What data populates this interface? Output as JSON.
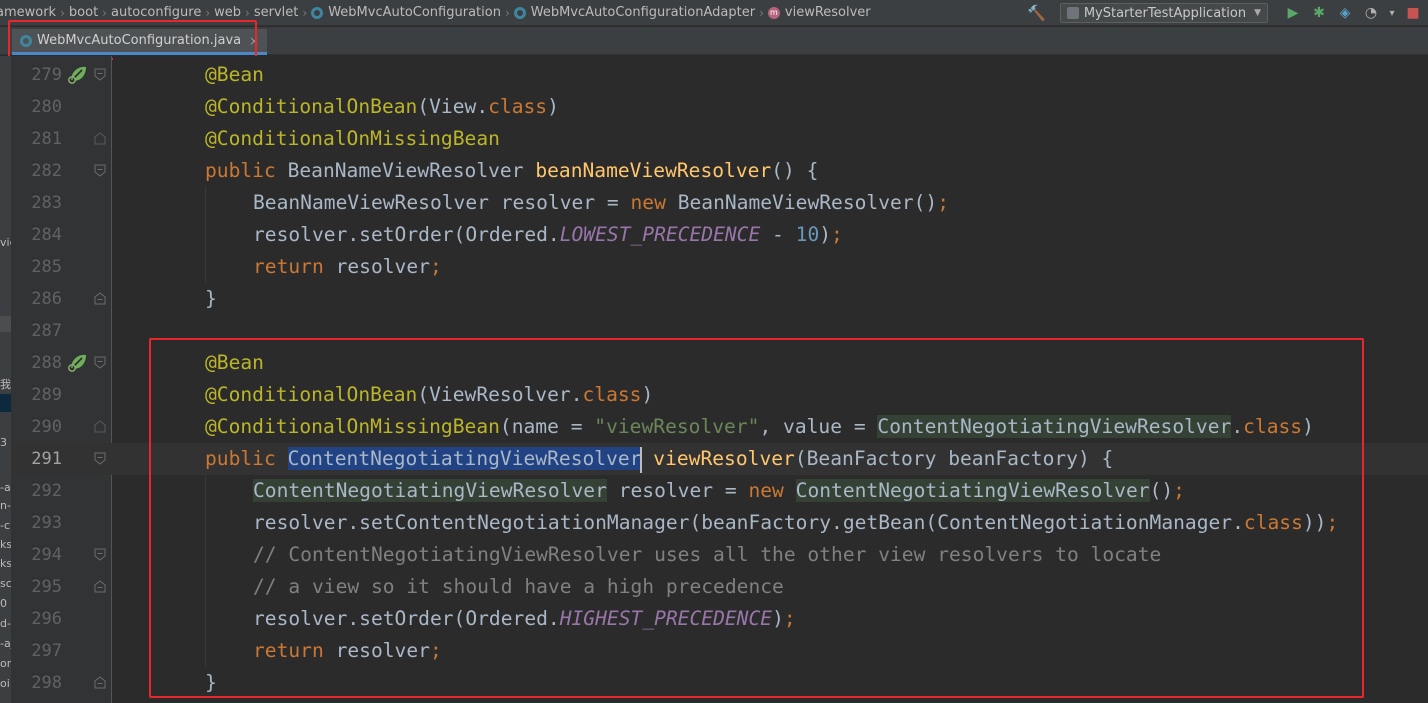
{
  "breadcrumb": {
    "items": [
      "amework",
      "boot",
      "autoconfigure",
      "web",
      "servlet",
      "WebMvcAutoConfiguration",
      "WebMvcAutoConfigurationAdapter",
      "viewResolver"
    ],
    "icons": [
      "",
      "",
      "",
      "",
      "",
      "class-icon",
      "class-icon",
      "method-icon"
    ]
  },
  "toolbar": {
    "run_config": "MyStarterTestApplication",
    "build_icon": "hammer-icon",
    "run_icon": "play-icon",
    "debug_icon": "bug-icon",
    "coverage_icon": "coverage-icon",
    "profile_icon": "profile-icon"
  },
  "tabs": [
    {
      "label": "WebMvcAutoConfiguration.java",
      "active": true,
      "close": "×"
    }
  ],
  "left_panel": {
    "fragments": [
      "vic",
      "我",
      "3",
      "-a",
      "n-c",
      "-c",
      "ks",
      "ks",
      "sc",
      "0",
      "d-",
      "-aj",
      "on",
      "oi:"
    ]
  },
  "editor": {
    "current_line": 291,
    "colors": {
      "background": "#2b2b2b",
      "gutter": "#313335",
      "annotation": "#bbb529",
      "keyword": "#cc7832",
      "string": "#6a8759",
      "number": "#6897bb",
      "method": "#ffc66d",
      "constant": "#9876aa",
      "comment": "#808080",
      "selection": "#214283",
      "highlight_box": "#e8262c"
    },
    "lines": [
      {
        "num": "279",
        "bean_icon": true,
        "fold": "start"
      },
      {
        "num": "280"
      },
      {
        "num": "281",
        "fold": "end-mark"
      },
      {
        "num": "282",
        "fold": "start"
      },
      {
        "num": "283"
      },
      {
        "num": "284"
      },
      {
        "num": "285"
      },
      {
        "num": "286",
        "fold": "end"
      },
      {
        "num": "287"
      },
      {
        "num": "288",
        "bean_icon": true,
        "fold": "start"
      },
      {
        "num": "289"
      },
      {
        "num": "290",
        "fold": "end-mark"
      },
      {
        "num": "291",
        "fold": "start"
      },
      {
        "num": "292"
      },
      {
        "num": "293"
      },
      {
        "num": "294",
        "fold": "start"
      },
      {
        "num": "295",
        "fold": "end"
      },
      {
        "num": "296"
      },
      {
        "num": "297"
      },
      {
        "num": "298",
        "fold": "end"
      }
    ],
    "tokens": {
      "l279": [
        "@Bean"
      ],
      "l280": [
        "@ConditionalOnBean",
        "(View.",
        "class",
        ")"
      ],
      "l281": [
        "@ConditionalOnMissingBean"
      ],
      "l282": [
        "public ",
        "BeanNameViewResolver ",
        "beanNameViewResolver",
        "() {"
      ],
      "l283": [
        "BeanNameViewResolver resolver = ",
        "new ",
        "BeanNameViewResolver()",
        ";"
      ],
      "l284": [
        "resolver.setOrder(Ordered.",
        "LOWEST_PRECEDENCE",
        " - ",
        "10",
        ")",
        ";"
      ],
      "l285": [
        "return ",
        "resolver",
        ";"
      ],
      "l286": [
        "}"
      ],
      "l288": [
        "@Bean"
      ],
      "l289": [
        "@ConditionalOnBean",
        "(ViewResolver.",
        "class",
        ")"
      ],
      "l290": [
        "@ConditionalOnMissingBean",
        "(name = ",
        "\"viewResolver\"",
        ", value = ",
        "ContentNegotiatingViewResolver",
        ".",
        "class",
        ")"
      ],
      "l291": [
        "public ",
        "ContentNegotiatingViewResolver",
        " ",
        "viewResolver",
        "(BeanFactory beanFactory) {"
      ],
      "l292": [
        "ContentNegotiatingViewResolver",
        " resolver = ",
        "new ",
        "ContentNegotiatingViewResolver",
        "()",
        ";"
      ],
      "l293": [
        "resolver.setContentNegotiationManager(beanFactory.getBean(ContentNegotiationManager.",
        "class",
        "))",
        ";"
      ],
      "l294": [
        "// ContentNegotiatingViewResolver uses all the other view resolvers to locate"
      ],
      "l295": [
        "// a view so it should have a high precedence"
      ],
      "l296": [
        "resolver.setOrder(Ordered.",
        "HIGHEST_PRECEDENCE",
        ")",
        ";"
      ],
      "l297": [
        "return ",
        "resolver",
        ";"
      ],
      "l298": [
        "}"
      ]
    }
  }
}
